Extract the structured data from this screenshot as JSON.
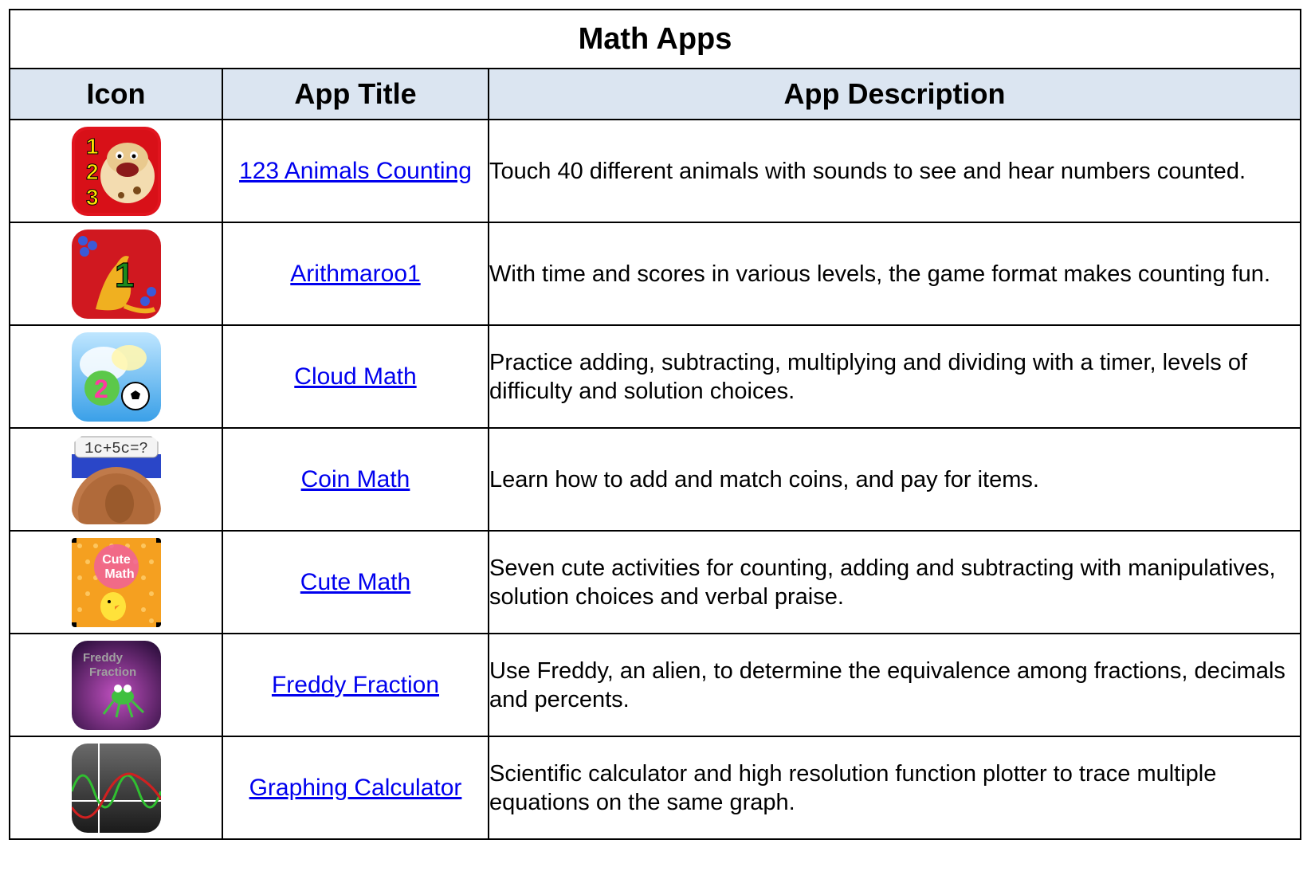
{
  "table": {
    "title": "Math Apps",
    "headers": {
      "icon": "Icon",
      "title": "App Title",
      "description": "App Description"
    },
    "rows": [
      {
        "icon_name": "animals-counting-icon",
        "title": "123 Animals Counting",
        "description": "Touch 40 different animals with sounds to see and hear numbers counted."
      },
      {
        "icon_name": "kangaroo-icon",
        "title": "Arithmaroo1",
        "description": "With time and scores in various levels, the game format makes counting fun."
      },
      {
        "icon_name": "cloud-math-icon",
        "title": "Cloud Math",
        "description": "Practice adding, subtracting, multiplying and dividing with a timer, levels of difficulty and solution choices."
      },
      {
        "icon_name": "coin-math-icon",
        "title": "Coin Math",
        "description": "Learn how to add and match coins, and pay for items."
      },
      {
        "icon_name": "cute-math-icon",
        "title": "Cute Math",
        "description": "Seven cute activities for counting, adding and subtracting with manipulatives, solution choices and verbal praise."
      },
      {
        "icon_name": "freddy-fraction-icon",
        "title": "Freddy Fraction",
        "description": "Use Freddy, an alien, to determine the equivalence among fractions, decimals and percents."
      },
      {
        "icon_name": "graphing-calculator-icon",
        "title": "Graphing Calculator",
        "description": "Scientific calculator and high resolution function plotter to trace multiple equations on the same graph."
      }
    ],
    "icon_text": {
      "counting_digits": [
        "1",
        "2",
        "3"
      ],
      "arithmaroo_digit": "1",
      "cloud_digit": "2",
      "coin_equation": "1c+5c=?",
      "cute_word_1": "Cute",
      "cute_word_2": "Math",
      "freddy_word_1": "Freddy",
      "freddy_word_2": "Fraction"
    },
    "colors": {
      "header_bg": "#dbe5f1",
      "link": "#0000ee",
      "border": "#000000"
    }
  }
}
